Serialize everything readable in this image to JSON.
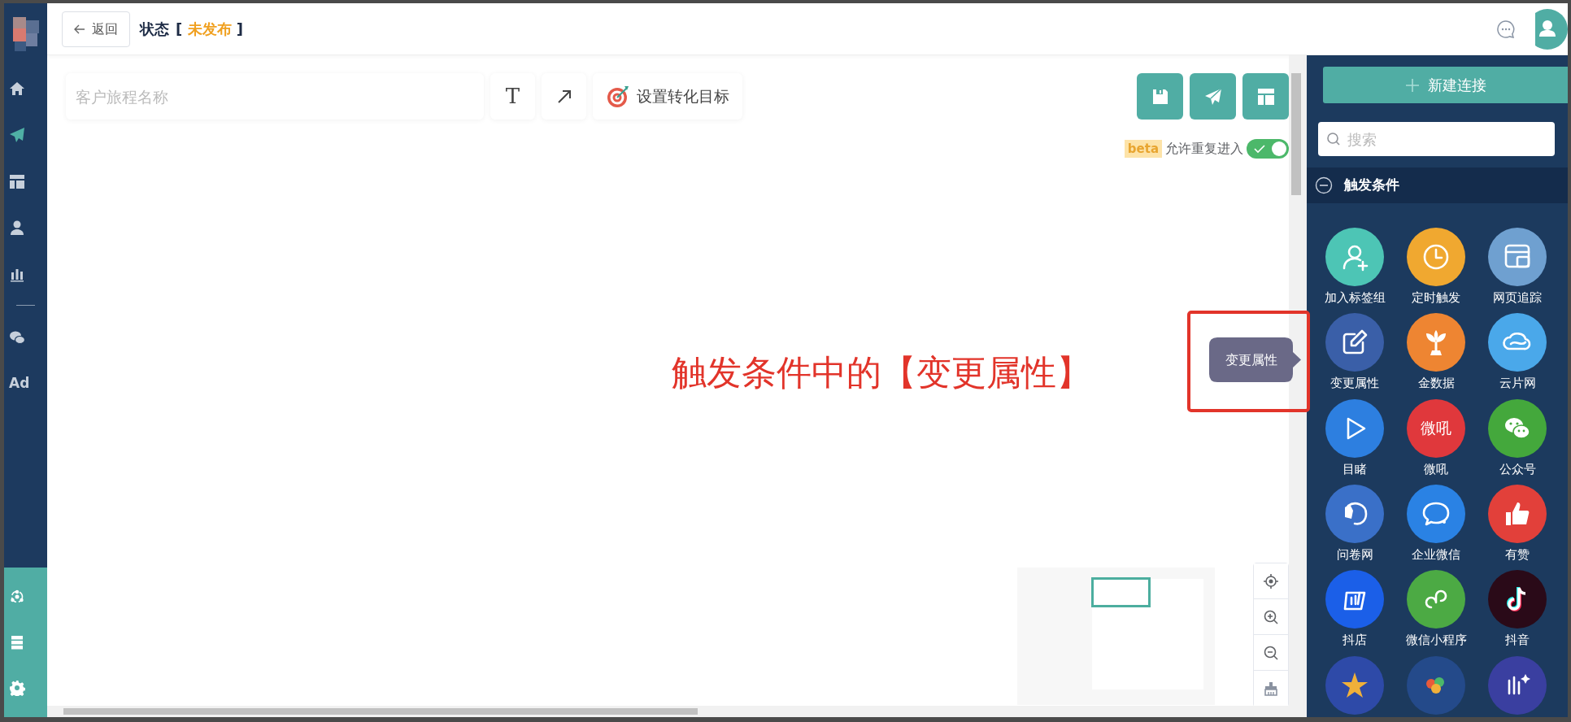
{
  "sidebar": {
    "items": [
      {
        "selected": false
      },
      {
        "selected": true
      },
      {
        "selected": false
      },
      {
        "selected": false
      },
      {
        "selected": false
      },
      {
        "kind": "divider"
      },
      {
        "selected": false
      },
      {
        "label": "Ad",
        "selected": false
      }
    ]
  },
  "header": {
    "back": "返回",
    "status_label": "状态",
    "status_open": "[",
    "status_value": "未发布",
    "status_close": "]"
  },
  "toolbar": {
    "name_placeholder": "客户旅程名称",
    "text_tool": "T",
    "goal_button": "设置转化目标"
  },
  "repeat_entry": {
    "badge": "beta",
    "label": "允许重复进入",
    "on": true
  },
  "panel": {
    "new_button": "新建连接",
    "search_placeholder": "搜索",
    "section": "触发条件",
    "expanded": true,
    "tiles": [
      {
        "label": "加入标签组",
        "color": "#4dc5b5"
      },
      {
        "label": "定时触发",
        "color": "#f0a830"
      },
      {
        "label": "网页追踪",
        "color": "#6fa0d0"
      },
      {
        "label": "变更属性",
        "color": "#3a5fa8"
      },
      {
        "label": "金数据",
        "color": "#ee8532"
      },
      {
        "label": "云片网",
        "color": "#4aa8ea"
      },
      {
        "label": "目睹",
        "color": "#2d7fe0"
      },
      {
        "label": "微吼",
        "color": "#e0383c",
        "kind": "text-logo"
      },
      {
        "label": "公众号",
        "color": "#44a83c"
      },
      {
        "label": "问卷网",
        "color": "#3a70c8"
      },
      {
        "label": "企业微信",
        "color": "#2a82e4"
      },
      {
        "label": "有赞",
        "color": "#e2403a"
      },
      {
        "label": "抖店",
        "color": "#1b5fe8"
      },
      {
        "label": "微信小程序",
        "color": "#4caa44"
      },
      {
        "label": "抖音",
        "color": "#2a0a18"
      },
      {
        "color": "#2e4aa8"
      },
      {
        "color": "#244a8a"
      },
      {
        "color": "#3a3fa0"
      }
    ],
    "logo_texts": [
      "微吼"
    ]
  },
  "tooltip": "变更属性",
  "annotation": "触发条件中的【变更属性】"
}
